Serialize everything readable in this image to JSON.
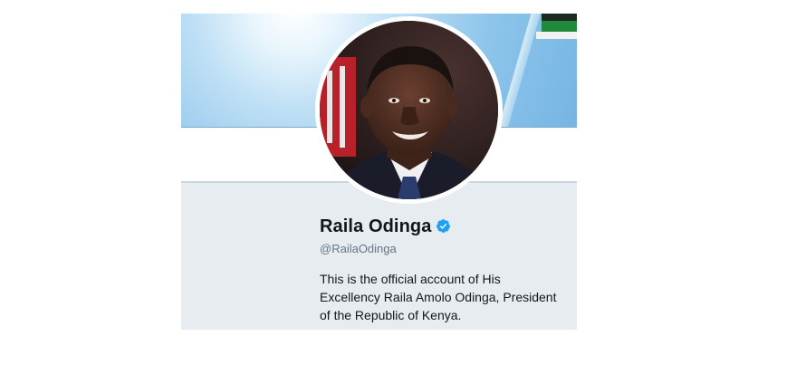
{
  "profile": {
    "name": "Raila Odinga",
    "handle": "@RailaOdinga",
    "bio": "This is the official account of His Excellency Raila Amolo Odinga, President of the Republic of Kenya.",
    "verified": true,
    "verified_icon": "verified-badge-icon"
  },
  "colors": {
    "verified_blue": "#1da1f2",
    "profile_background": "#e6ecf0",
    "handle_gray": "#657786"
  }
}
